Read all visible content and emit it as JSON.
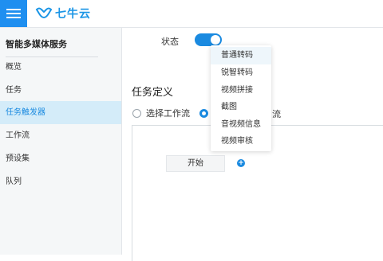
{
  "header": {
    "logo_text": "七牛云"
  },
  "sidebar": {
    "title": "智能多媒体服务",
    "items": [
      {
        "label": "概览"
      },
      {
        "label": "任务"
      },
      {
        "label": "任务触发器",
        "active": true
      },
      {
        "label": "工作流"
      },
      {
        "label": "预设集"
      },
      {
        "label": "队列"
      }
    ]
  },
  "main": {
    "status_label": "状态",
    "status_on": true,
    "section_title": "任务定义",
    "radios": [
      {
        "label": "选择工作流",
        "checked": false
      },
      {
        "label": "流",
        "checked": true
      }
    ],
    "start_node_label": "开始"
  },
  "dropdown": {
    "items": [
      "普通转码",
      "锐智转码",
      "视频拼接",
      "截图",
      "音视频信息",
      "视频审核"
    ]
  },
  "colors": {
    "accent": "#1a8ae0",
    "active_nav_bg": "#d4ecf9"
  }
}
